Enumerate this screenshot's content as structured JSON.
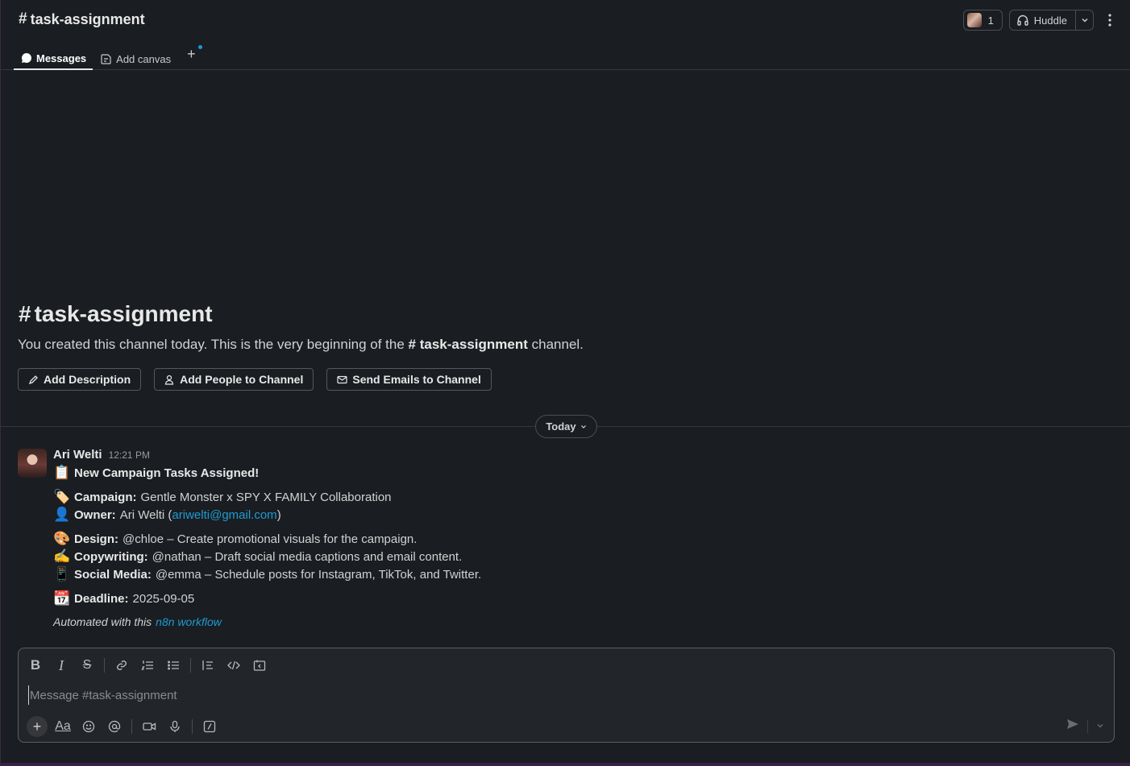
{
  "header": {
    "channel_name": "task-assignment",
    "hash": "#",
    "members_count": "1",
    "huddle_label": "Huddle"
  },
  "tabs": [
    {
      "label": "Messages",
      "icon": "message-bubble-icon",
      "active": true
    },
    {
      "label": "Add canvas",
      "icon": "canvas-icon",
      "active": false
    }
  ],
  "intro": {
    "title": "task-assignment",
    "text_before": "You created this channel today. This is the very beginning of the",
    "text_channel": "task-assignment",
    "text_after": "channel.",
    "buttons": {
      "add_description": "Add Description",
      "add_people": "Add People to Channel",
      "send_emails": "Send Emails to Channel"
    }
  },
  "divider": {
    "label": "Today"
  },
  "message": {
    "author": "Ari Welti",
    "time": "12:21 PM",
    "title": "New Campaign Tasks Assigned!",
    "campaign_label": "Campaign:",
    "campaign_value": "Gentle Monster x SPY X FAMILY Collaboration",
    "owner_label": "Owner:",
    "owner_name": "Ari Welti (",
    "owner_email": "ariwelti@gmail.com",
    "owner_close": ")",
    "design_label": "Design:",
    "design_value": "@chloe – Create promotional visuals for the campaign.",
    "copy_label": "Copywriting:",
    "copy_value": "@nathan – Draft social media captions and email content.",
    "social_label": "Social Media:",
    "social_value": "@emma – Schedule posts for Instagram, TikTok, and Twitter.",
    "deadline_label": "Deadline:",
    "deadline_value": "2025-09-05",
    "footer_text": "Automated with this",
    "footer_link": "n8n workflow"
  },
  "composer": {
    "placeholder": "Message #task-assignment",
    "value": ""
  },
  "colors": {
    "background": "#1a1d21",
    "link": "#1d9bd1",
    "border": "#35373b"
  }
}
